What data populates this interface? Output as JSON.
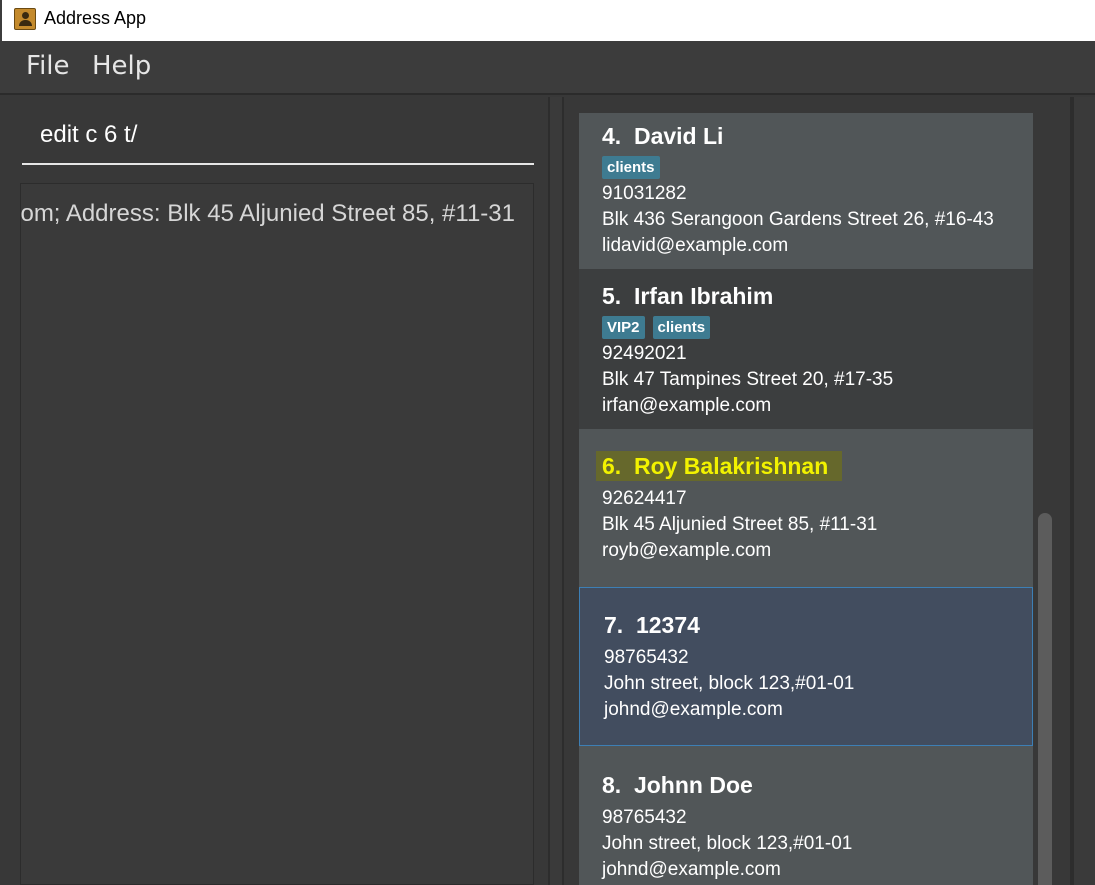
{
  "window": {
    "title": "Address App"
  },
  "menu": {
    "file": "File",
    "help": "Help"
  },
  "command": {
    "value": "edit c 6 t/"
  },
  "result": {
    "text": "om; Address: Blk 45 Aljunied Street 85, #11-31"
  },
  "persons": [
    {
      "index": "4.",
      "name": "David Li",
      "tags": [
        "clients"
      ],
      "phone": "91031282",
      "address": "Blk 436 Serangoon Gardens Street 26, #16-43",
      "email": "lidavid@example.com"
    },
    {
      "index": "5.",
      "name": "Irfan Ibrahim",
      "tags": [
        "VIP2",
        "clients"
      ],
      "phone": "92492021",
      "address": "Blk 47 Tampines Street 20, #17-35",
      "email": "irfan@example.com"
    },
    {
      "index": "6.",
      "name": "Roy Balakrishnan",
      "tags": [],
      "phone": "92624417",
      "address": "Blk 45 Aljunied Street 85, #11-31",
      "email": "royb@example.com"
    },
    {
      "index": "7.",
      "name": "12374",
      "tags": [],
      "phone": "98765432",
      "address": "John street, block 123,#01-01",
      "email": "johnd@example.com"
    },
    {
      "index": "8.",
      "name": "Johnn Doe",
      "tags": [],
      "phone": "98765432",
      "address": "John street, block 123,#01-01",
      "email": "johnd@example.com"
    }
  ],
  "colors": {
    "highlight_text": "#f2f200",
    "tag_bg": "#3e7b91",
    "selected_border": "#3d7fb5"
  }
}
